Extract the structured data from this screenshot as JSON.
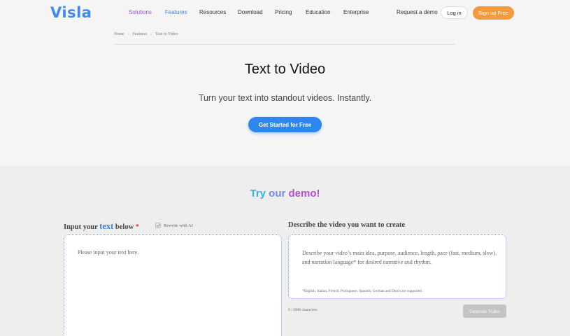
{
  "header": {
    "logo": "Visla",
    "nav": [
      {
        "label": "Solutions"
      },
      {
        "label": "Features"
      },
      {
        "label": "Resources"
      },
      {
        "label": "Download"
      },
      {
        "label": "Pricing"
      },
      {
        "label": "Education"
      },
      {
        "label": "Enterprise"
      }
    ],
    "request_demo": "Request a demo",
    "login": "Log in",
    "signup": "Sign up Free"
  },
  "breadcrumb": [
    "Home",
    "Features",
    "Text to Video"
  ],
  "breadcrumb_sep": "›",
  "hero": {
    "title": "Text to Video",
    "subtitle": "Turn your text into standout videos. Instantly.",
    "cta": "Get Started for Free"
  },
  "demo": {
    "title_try": "Try",
    "title_our": "our",
    "title_demo": "demo!",
    "input_label_prefix": "Input your",
    "input_label_keyword": "text",
    "input_label_suffix": "below",
    "required_mark": "*",
    "rewrite_label": "Rewrite with AI",
    "rewrite_checked": true,
    "text_placeholder": "Please input your text here.",
    "describe_label": "Describe the video you want to create",
    "describe_placeholder": "Describe your video’s main idea, purpose, audience, length, pace (fast, medium, slow), and narration language* for desired narrative and rhythm.",
    "language_note": "*English, Italian, French, Portuguese, Spanish, German and Dutch are supported",
    "char_count": "0 / 2000 characters",
    "generate_button": "Generate Video"
  },
  "colors": {
    "brand_blue": "#3d8af0",
    "cta_blue": "#2f86ee",
    "signup_orange": "#f59a3c",
    "solutions_purple": "#9b4fd8"
  }
}
